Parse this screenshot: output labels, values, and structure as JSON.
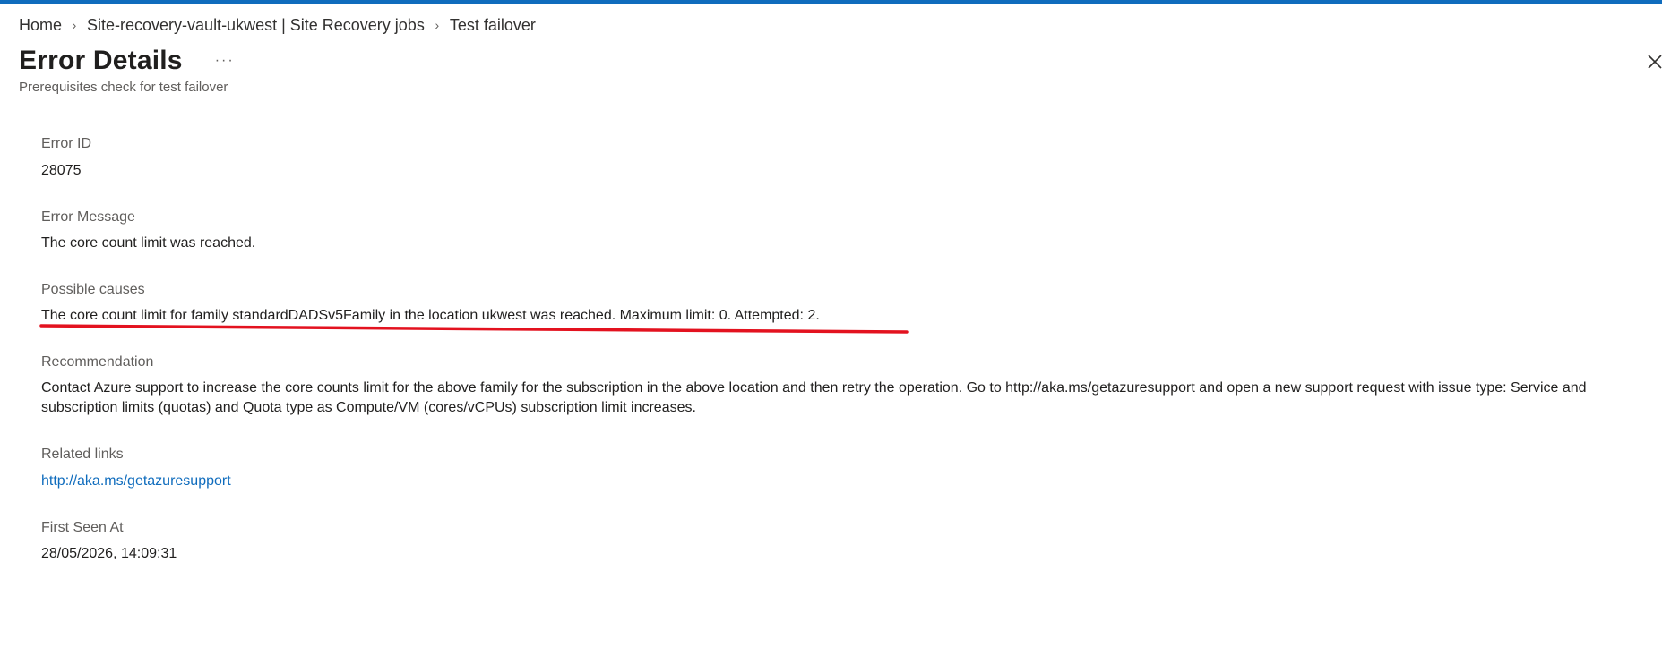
{
  "breadcrumb": {
    "home": "Home",
    "vault": "Site-recovery-vault-ukwest | Site Recovery jobs",
    "current": "Test failover",
    "separator": "›"
  },
  "header": {
    "title": "Error Details",
    "more_label": "···",
    "subtitle": "Prerequisites check for test failover"
  },
  "fields": {
    "error_id": {
      "label": "Error ID",
      "value": "28075"
    },
    "error_message": {
      "label": "Error Message",
      "value": "The core count limit was reached."
    },
    "possible_causes": {
      "label": "Possible causes",
      "value": "The core count limit for family standardDADSv5Family in the location ukwest was reached. Maximum limit: 0. Attempted: 2."
    },
    "recommendation": {
      "label": "Recommendation",
      "value": "Contact Azure support to increase the core counts limit for the above family for the subscription in the above location and then retry the operation. Go to http://aka.ms/getazuresupport and open a new support request with issue type: Service and subscription limits (quotas) and Quota type as Compute/VM (cores/vCPUs) subscription limit increases."
    },
    "related_links": {
      "label": "Related links",
      "value": "http://aka.ms/getazuresupport"
    },
    "first_seen_at": {
      "label": "First Seen At",
      "value": "28/05/2026, 14:09:31"
    }
  },
  "colors": {
    "accent": "#0f6cbd",
    "annotation_underline": "#e3121f",
    "link": "#0f6cbd"
  },
  "icons": {
    "close": "close-icon",
    "more": "more-icon",
    "chevron": "chevron-right-icon"
  }
}
